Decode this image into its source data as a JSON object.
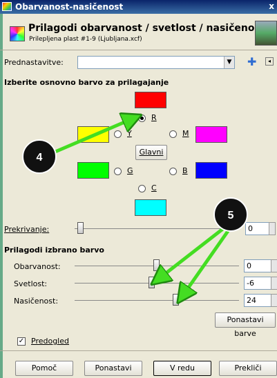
{
  "window": {
    "title": "Obarvanost-nasičenost",
    "close_glyph": "x"
  },
  "header": {
    "title": "Prilagodi obarvanost / svetlost / nasičenost",
    "subtitle": "Prilepljena plast #1-9 (Ljubljana.xcf)"
  },
  "presets": {
    "label": "Prednastavitve:",
    "value": "",
    "arrow": "▼",
    "add_glyph": "✚",
    "menu_glyph": "◂"
  },
  "primary_section": {
    "title": "Izberite osnovno barvo za prilagajanje",
    "colors": {
      "R": {
        "label": "R",
        "hex": "#ff0000",
        "selected": true
      },
      "Y": {
        "label": "Y",
        "hex": "#ffff00",
        "selected": false
      },
      "M": {
        "label": "M",
        "hex": "#ff00ff",
        "selected": false
      },
      "G": {
        "label": "G",
        "hex": "#00ff00",
        "selected": false
      },
      "B": {
        "label": "B",
        "hex": "#0000ff",
        "selected": false
      },
      "C": {
        "label": "C",
        "hex": "#00ffff",
        "selected": false
      }
    },
    "master_button": "Glavni"
  },
  "overlap": {
    "label": "Prekrivanje:",
    "value": "0"
  },
  "adjust_section": {
    "title": "Prilagodi izbrano barvo",
    "hue": {
      "label": "Obarvanost:",
      "value": "0"
    },
    "lightness": {
      "label": "Svetlost:",
      "value": "-6"
    },
    "saturation": {
      "label": "Nasičenost:",
      "value": "24"
    },
    "reset_color_button": "Ponastavi barve"
  },
  "preview": {
    "label": "Predogled",
    "checked": true,
    "check_glyph": "✓"
  },
  "buttons": {
    "help": "Pomoč",
    "reset": "Ponastavi",
    "ok": "V redu",
    "cancel": "Prekliči"
  },
  "annotations": {
    "callout_4": "4",
    "callout_5": "5",
    "arrow_color": "#44dd22"
  }
}
